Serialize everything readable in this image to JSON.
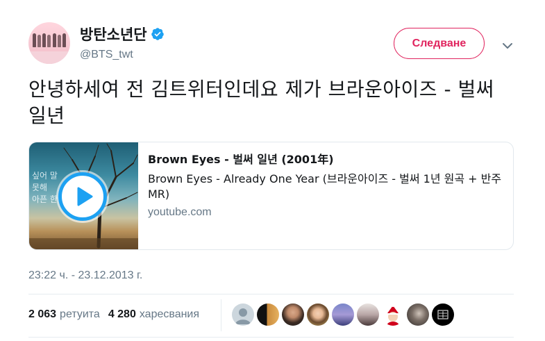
{
  "author": {
    "display_name": "방탄소년단",
    "handle": "@BTS_twt",
    "verified_icon": "verified-badge-icon"
  },
  "follow_button": {
    "label": "Следване",
    "color": "#e0245e"
  },
  "tweet": {
    "text": "안녕하세여 전 김트위터인데요 제가 브라운아이즈 - 벌써 일년"
  },
  "card": {
    "title": "Brown Eyes - 벌써 일년 (2001年)",
    "description": "Brown Eyes - Already One Year (브라운아이즈 - 벌써 1년 원곡 + 반주 MR)",
    "domain": "youtube.com",
    "thumbnail_text": "싶어 말 못해 아픈 한"
  },
  "timestamp": "23:22 ч. - 23.12.2013 г.",
  "stats": {
    "retweets": {
      "count": "2 063",
      "label": "ретуита"
    },
    "likes": {
      "count": "4 280",
      "label": "харесвания"
    }
  },
  "colors": {
    "accent": "#1da1f2",
    "follow": "#e0245e",
    "secondary_text": "#657786"
  }
}
